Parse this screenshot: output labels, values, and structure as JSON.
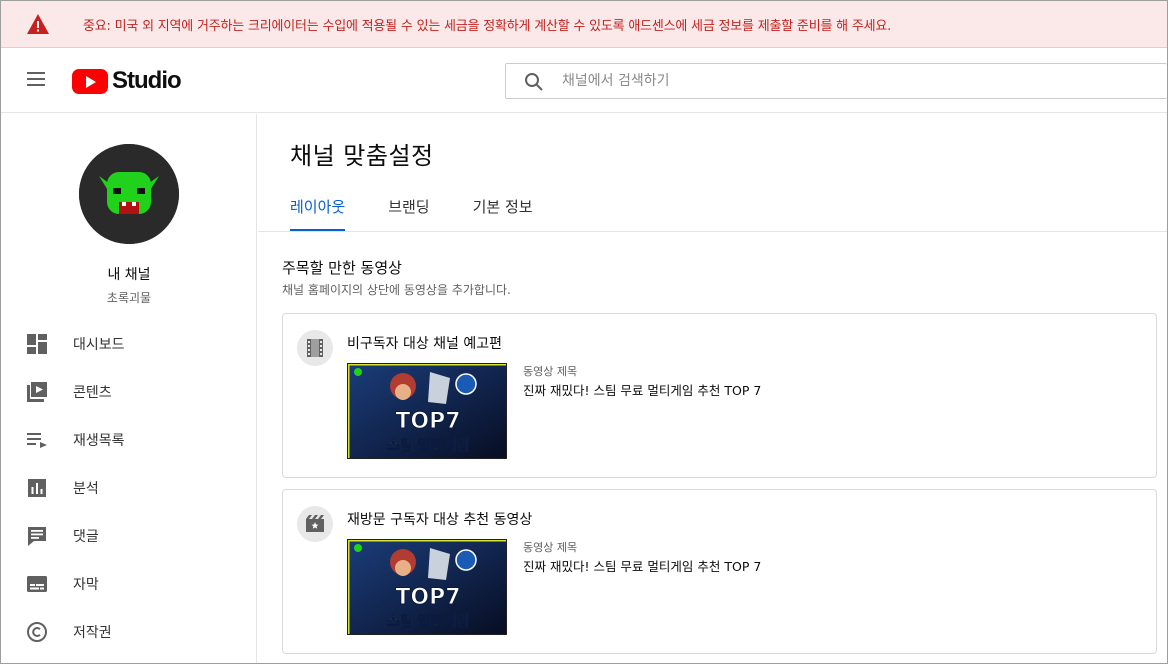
{
  "banner": {
    "message": "중요: 미국 외 지역에 거주하는 크리에이터는 수입에 적용될 수 있는 세금을 정확하게 계산할 수 있도록 애드센스에 세금 정보를 제출할 준비를 해 주세요.",
    "icon": "warning-icon",
    "color": "#c5221f"
  },
  "header": {
    "logo_text": "Studio",
    "search_placeholder": "채널에서 검색하기"
  },
  "sidebar": {
    "channel_title": "내 채널",
    "channel_name": "초록괴물",
    "items": [
      {
        "label": "대시보드",
        "icon": "dashboard-icon"
      },
      {
        "label": "콘텐츠",
        "icon": "content-icon"
      },
      {
        "label": "재생목록",
        "icon": "playlist-icon"
      },
      {
        "label": "분석",
        "icon": "analytics-icon"
      },
      {
        "label": "댓글",
        "icon": "comments-icon"
      },
      {
        "label": "자막",
        "icon": "subtitles-icon"
      },
      {
        "label": "저작권",
        "icon": "copyright-icon"
      }
    ]
  },
  "main": {
    "page_title": "채널 맞춤설정",
    "tabs": [
      {
        "label": "레이아웃",
        "active": true
      },
      {
        "label": "브랜딩",
        "active": false
      },
      {
        "label": "기본 정보",
        "active": false
      }
    ],
    "section_title": "주목할 만한 동영상",
    "section_desc": "채널 홈페이지의 상단에 동영상을 추가합니다.",
    "cards": [
      {
        "title": "비구독자 대상 채널 예고편",
        "icon": "film-icon",
        "video_label": "동영상 제목",
        "video_title": "진짜 재밌다! 스팀 무료 멀티게임 추천 TOP 7",
        "thumb_line1": "TOP7",
        "thumb_line2": "스팀 멀티게임"
      },
      {
        "title": "재방문 구독자 대상 추천 동영상",
        "icon": "featured-video-icon",
        "video_label": "동영상 제목",
        "video_title": "진짜 재밌다! 스팀 무료 멀티게임 추천 TOP 7",
        "thumb_line1": "TOP7",
        "thumb_line2": "스팀 멀티게임"
      }
    ]
  },
  "colors": {
    "accent": "#065fd4",
    "brand_red": "#ff0000",
    "avatar_green": "#21d21d"
  }
}
